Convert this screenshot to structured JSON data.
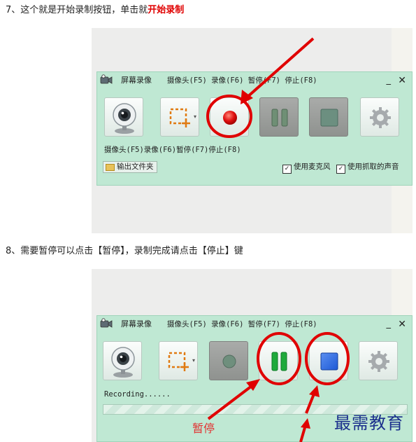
{
  "step7": {
    "text": "7、这个就是开始录制按钮，单击就",
    "highlight": "开始录制"
  },
  "step8": {
    "text": "8、需要暂停可以点击【暂停】，录制完成请点击【停止】键"
  },
  "window1": {
    "title": "屏幕录像",
    "hotkeys": "摄像头(F5) 录像(F6) 暂停(F7) 停止(F8)",
    "minimize": "_",
    "close": "✕",
    "status": "摄像头(F5)录像(F6)暂停(F7)停止(F8)",
    "folder_button": "输出文件夹",
    "mic_checkbox": {
      "label": "使用麦克风",
      "checked": true
    },
    "capture_audio_checkbox": {
      "label": "使用抓取的声音",
      "checked": true
    },
    "check_mark": "✓"
  },
  "window2": {
    "title": "屏幕录像",
    "hotkeys": "摄像头(F5) 录像(F6) 暂停(F7) 停止(F8)",
    "minimize": "_",
    "close": "✕",
    "status": "Recording......"
  },
  "annotations": {
    "pause_label": "暂停",
    "watermark": "最需教育"
  },
  "icons": {
    "webcam": "webcam-icon",
    "region_select": "region-select-icon",
    "record": "record-icon",
    "pause": "pause-icon",
    "stop": "stop-icon",
    "settings": "gear-icon",
    "folder": "folder-icon"
  },
  "colors": {
    "window_bg": "#bfe8d3",
    "record_red": "#e01010",
    "pause_green": "#1faa3c",
    "stop_blue": "#1d59d6",
    "annotation_red": "#e00000",
    "watermark_blue": "#1b2f8c"
  }
}
